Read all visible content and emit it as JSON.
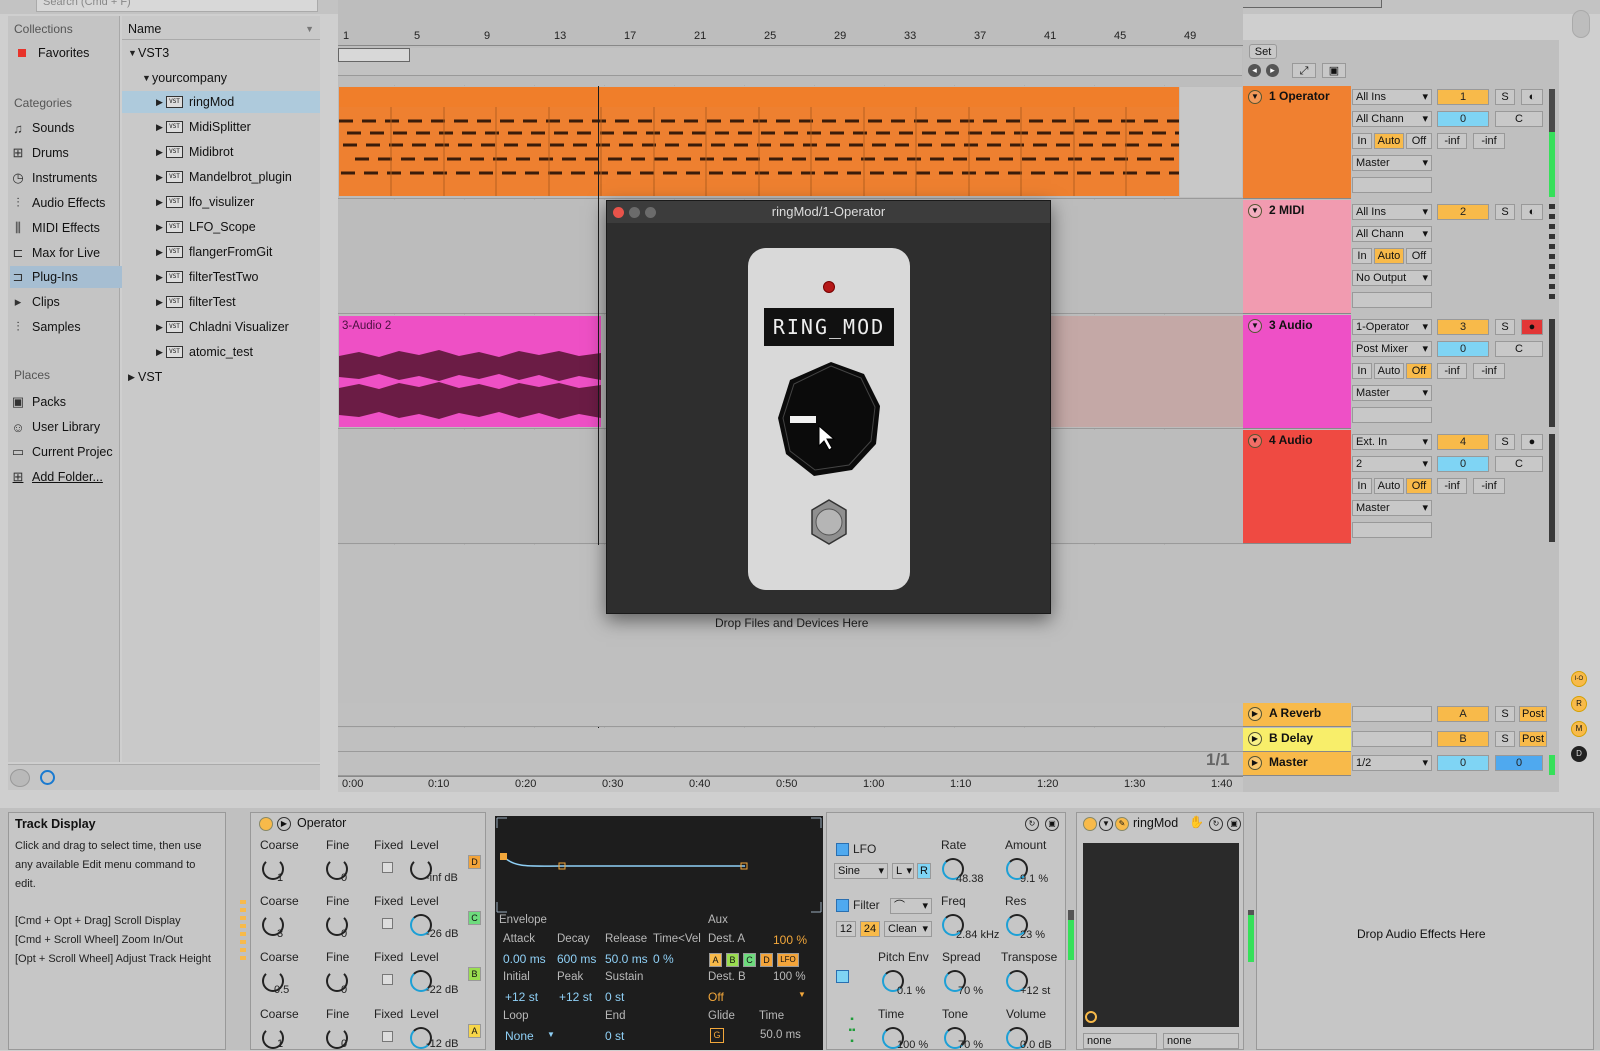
{
  "search": {
    "placeholder": "Search (Cmd + F)"
  },
  "browser": {
    "collections_title": "Collections",
    "favorites": "Favorites",
    "categories_title": "Categories",
    "categories": [
      "Sounds",
      "Drums",
      "Instruments",
      "Audio Effects",
      "MIDI Effects",
      "Max for Live",
      "Plug-Ins",
      "Clips",
      "Samples"
    ],
    "places_title": "Places",
    "places": [
      "Packs",
      "User Library",
      "Current Projec",
      "Add Folder..."
    ],
    "name_header": "Name",
    "tree": {
      "vst3": "VST3",
      "company": "yourcompany",
      "plugins": [
        "ringMod",
        "MidiSplitter",
        "Midibrot",
        "Mandelbrot_plugin",
        "lfo_visulizer",
        "LFO_Scope",
        "flangerFromGit",
        "filterTestTwo",
        "filterTest",
        "Chladni Visualizer",
        "atomic_test"
      ],
      "vst": "VST",
      "badge": "VST"
    }
  },
  "ruler": {
    "bars": [
      "1",
      "5",
      "9",
      "13",
      "17",
      "21",
      "25",
      "29",
      "33",
      "37",
      "41",
      "45",
      "49"
    ],
    "times": [
      "0:00",
      "0:10",
      "0:20",
      "0:30",
      "0:40",
      "0:50",
      "1:00",
      "1:10",
      "1:20",
      "1:30",
      "1:40"
    ],
    "set_label": "Set",
    "page": "1/1"
  },
  "clips": {
    "audio2": "3-Audio 2"
  },
  "drop_files": "Drop Files and Devices Here",
  "tracks": [
    {
      "name": "1 Operator",
      "color": "#f07f2a",
      "in": "All Ins",
      "ch": "All Chann",
      "monitor": [
        "In",
        "Auto",
        "Off"
      ],
      "out": "Master",
      "num": "1",
      "solo": "S",
      "vol": "0",
      "pan": "C",
      "inf1": "-inf",
      "inf2": "-inf"
    },
    {
      "name": "2 MIDI",
      "color": "#f19bb0",
      "in": "All Ins",
      "ch": "All Chann",
      "monitor": [
        "In",
        "Auto",
        "Off"
      ],
      "out": "No Output",
      "num": "2",
      "solo": "S"
    },
    {
      "name": "3 Audio",
      "color": "#ee4fc8",
      "in": "1-Operator",
      "ch": "Post Mixer",
      "monitor": [
        "In",
        "Auto",
        "Off"
      ],
      "out": "Master",
      "num": "3",
      "solo": "S",
      "vol": "0",
      "pan": "C",
      "inf1": "-inf",
      "inf2": "-inf"
    },
    {
      "name": "4 Audio",
      "color": "#ef4a42",
      "in": "Ext. In",
      "ch": "2",
      "monitor": [
        "In",
        "Auto",
        "Off"
      ],
      "out": "Master",
      "num": "4",
      "solo": "S",
      "vol": "0",
      "pan": "C",
      "inf1": "-inf",
      "inf2": "-inf"
    }
  ],
  "returns": [
    {
      "name": "A Reverb",
      "color": "#f8ba4a",
      "letter": "A",
      "solo": "S",
      "post": "Post"
    },
    {
      "name": "B Delay",
      "color": "#f8ee6a",
      "letter": "B",
      "solo": "S",
      "post": "Post"
    },
    {
      "name": "Master",
      "color": "#f8ba4a",
      "ch": "1/2",
      "vol": "0",
      "pan": "0"
    }
  ],
  "side_letters": [
    "I-O",
    "R",
    "M",
    "D"
  ],
  "plugin_window": {
    "title": "ringMod/1-Operator",
    "label": "RING_MOD"
  },
  "info": {
    "title": "Track Display",
    "body": "Click and drag to select time, then use any available Edit menu command to edit.",
    "shortcuts": [
      "[Cmd + Opt + Drag] Scroll Display",
      "[Cmd + Scroll Wheel] Zoom In/Out",
      "[Opt + Scroll Wheel] Adjust Track Height"
    ]
  },
  "operator": {
    "title": "Operator",
    "rows": [
      {
        "coarse": "1",
        "fine": "0",
        "level": "-inf dB",
        "osc": "D",
        "osc_color": "#f3a43a"
      },
      {
        "coarse": "3",
        "fine": "0",
        "level": "-26 dB",
        "osc": "C",
        "osc_color": "#6edb7d"
      },
      {
        "coarse": "0.5",
        "fine": "0",
        "level": "-22 dB",
        "osc": "B",
        "osc_color": "#9add50"
      },
      {
        "coarse": "1",
        "fine": "0",
        "level": "-12 dB",
        "osc": "A",
        "osc_color": "#f7d64a"
      }
    ],
    "labels": {
      "coarse": "Coarse",
      "fine": "Fine",
      "fixed": "Fixed",
      "level": "Level"
    },
    "envelope": {
      "title": "Envelope",
      "aux": "Aux",
      "attack_l": "Attack",
      "decay_l": "Decay",
      "release_l": "Release",
      "timevel_l": "Time<Vel",
      "attack": "0.00 ms",
      "decay": "600 ms",
      "release": "50.0 ms",
      "timevel": "0 %",
      "initial_l": "Initial",
      "peak_l": "Peak",
      "sustain_l": "Sustain",
      "initial": "+12 st",
      "peak": "+12 st",
      "sustain": "0 st",
      "loop_l": "Loop",
      "end_l": "End",
      "loop": "None",
      "end": "0 st",
      "dest_a_l": "Dest. A",
      "dest_a_pct": "100 %",
      "dest_btns": [
        "A",
        "B",
        "C",
        "D",
        "LFO"
      ],
      "dest_b_l": "Dest. B",
      "dest_b_pct": "100 %",
      "dest_b": "Off",
      "glide_l": "Glide",
      "glide": "G",
      "time_l": "Time",
      "time": "50.0 ms"
    },
    "lfo": {
      "lfo_l": "LFO",
      "wave": "Sine",
      "lr": "L",
      "r": "R",
      "rate_l": "Rate",
      "rate": "48.38",
      "amount_l": "Amount",
      "amount": "9.1 %",
      "filter_l": "Filter",
      "freq_l": "Freq",
      "freq": "2.84 kHz",
      "res_l": "Res",
      "res": "23 %",
      "f12": "12",
      "f24": "24",
      "clean": "Clean",
      "pitch_l": "Pitch Env",
      "pitch": "0.1 %",
      "spread_l": "Spread",
      "spread": "70 %",
      "transpose_l": "Transpose",
      "transpose": "+12 st",
      "time_l": "Time",
      "time": "100 %",
      "tone_l": "Tone",
      "tone": "70 %",
      "volume_l": "Volume",
      "volume": "0.0 dB"
    }
  },
  "ringmod_device": {
    "title": "ringMod",
    "none1": "none",
    "none2": "none"
  },
  "drop_audio": "Drop Audio Effects Here"
}
